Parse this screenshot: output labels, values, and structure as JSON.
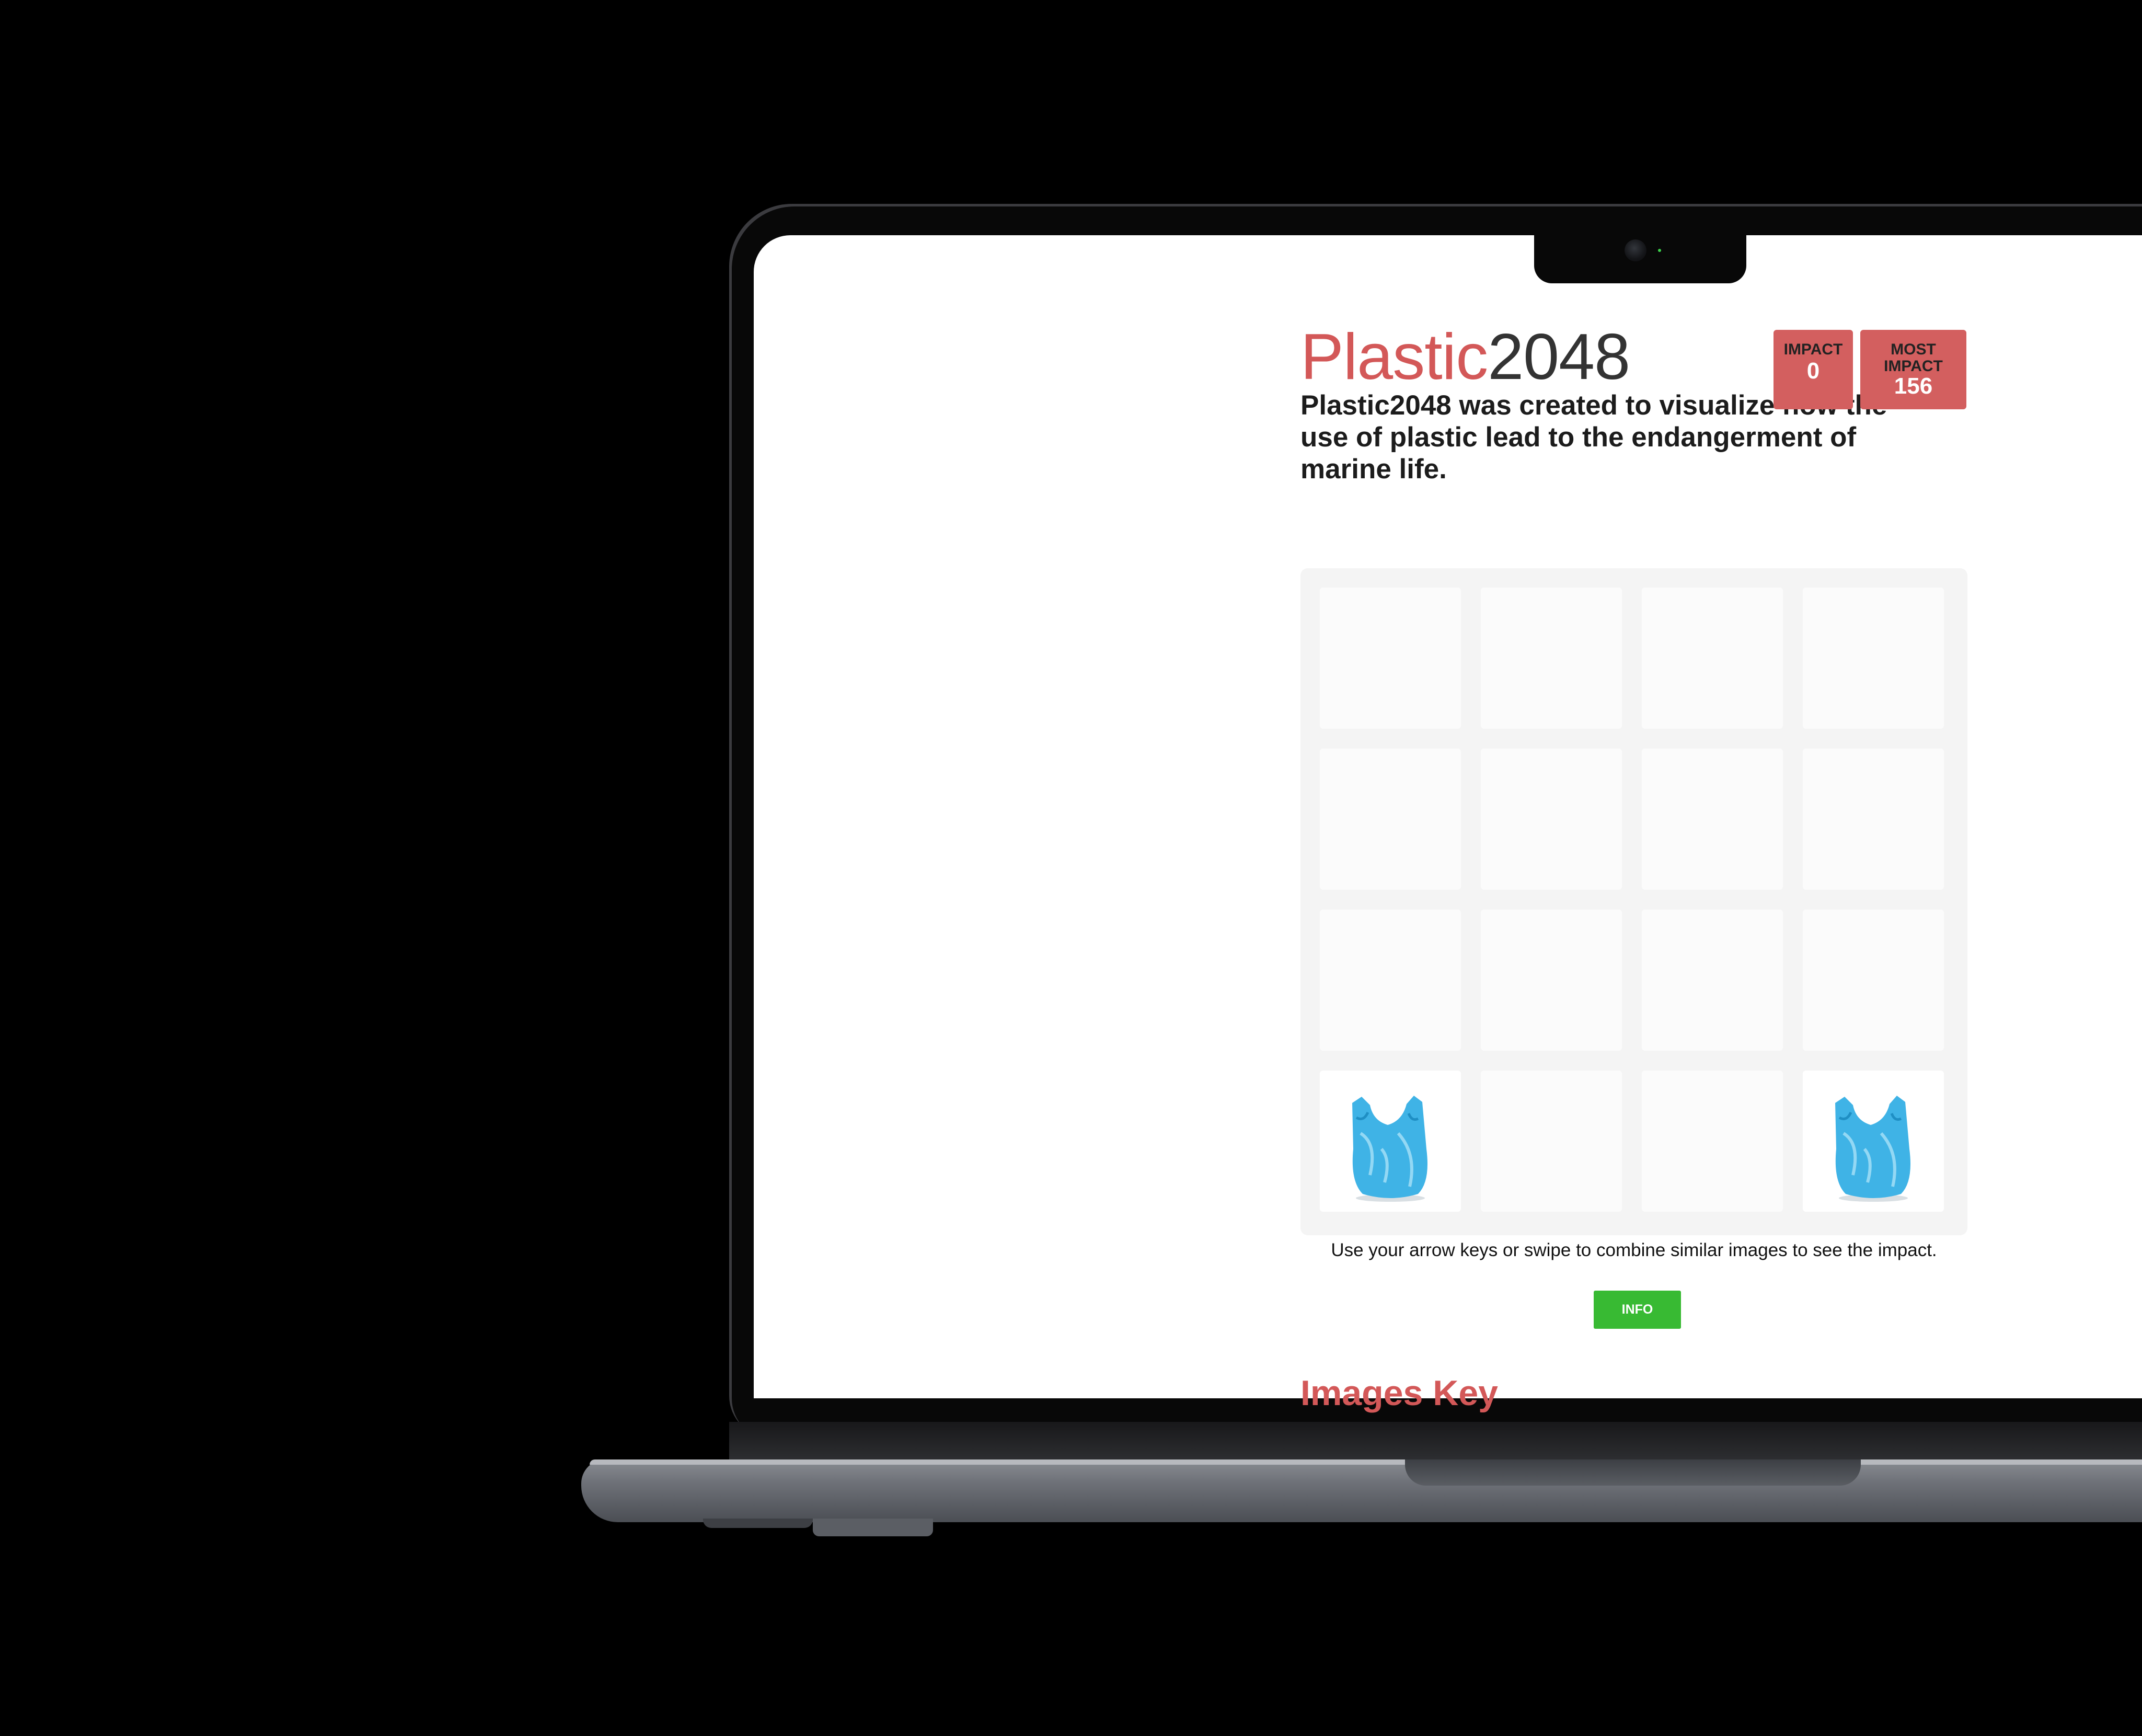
{
  "app": {
    "title_part1": "Plastic",
    "title_part2": "2048",
    "tagline": "Plastic2048 was created to visualize how the use of plastic lead to the endangerment of marine life."
  },
  "scores": {
    "current": {
      "label": "IMPACT",
      "value": "0"
    },
    "best": {
      "label": "MOST IMPACT",
      "value": "156"
    }
  },
  "board": {
    "size": 4,
    "tiles": [
      {
        "row": 3,
        "col": 0,
        "item": "plastic-bag"
      },
      {
        "row": 3,
        "col": 3,
        "item": "plastic-bag"
      }
    ]
  },
  "instructions": "Use your arrow keys or swipe to combine similar images to see the impact.",
  "info_button": "INFO",
  "images_key_heading": "Images Key",
  "colors": {
    "brand_red": "#d35858",
    "score_box": "#d35f5f",
    "info_green": "#38ba33",
    "bag_blue": "#3fb3e6"
  }
}
